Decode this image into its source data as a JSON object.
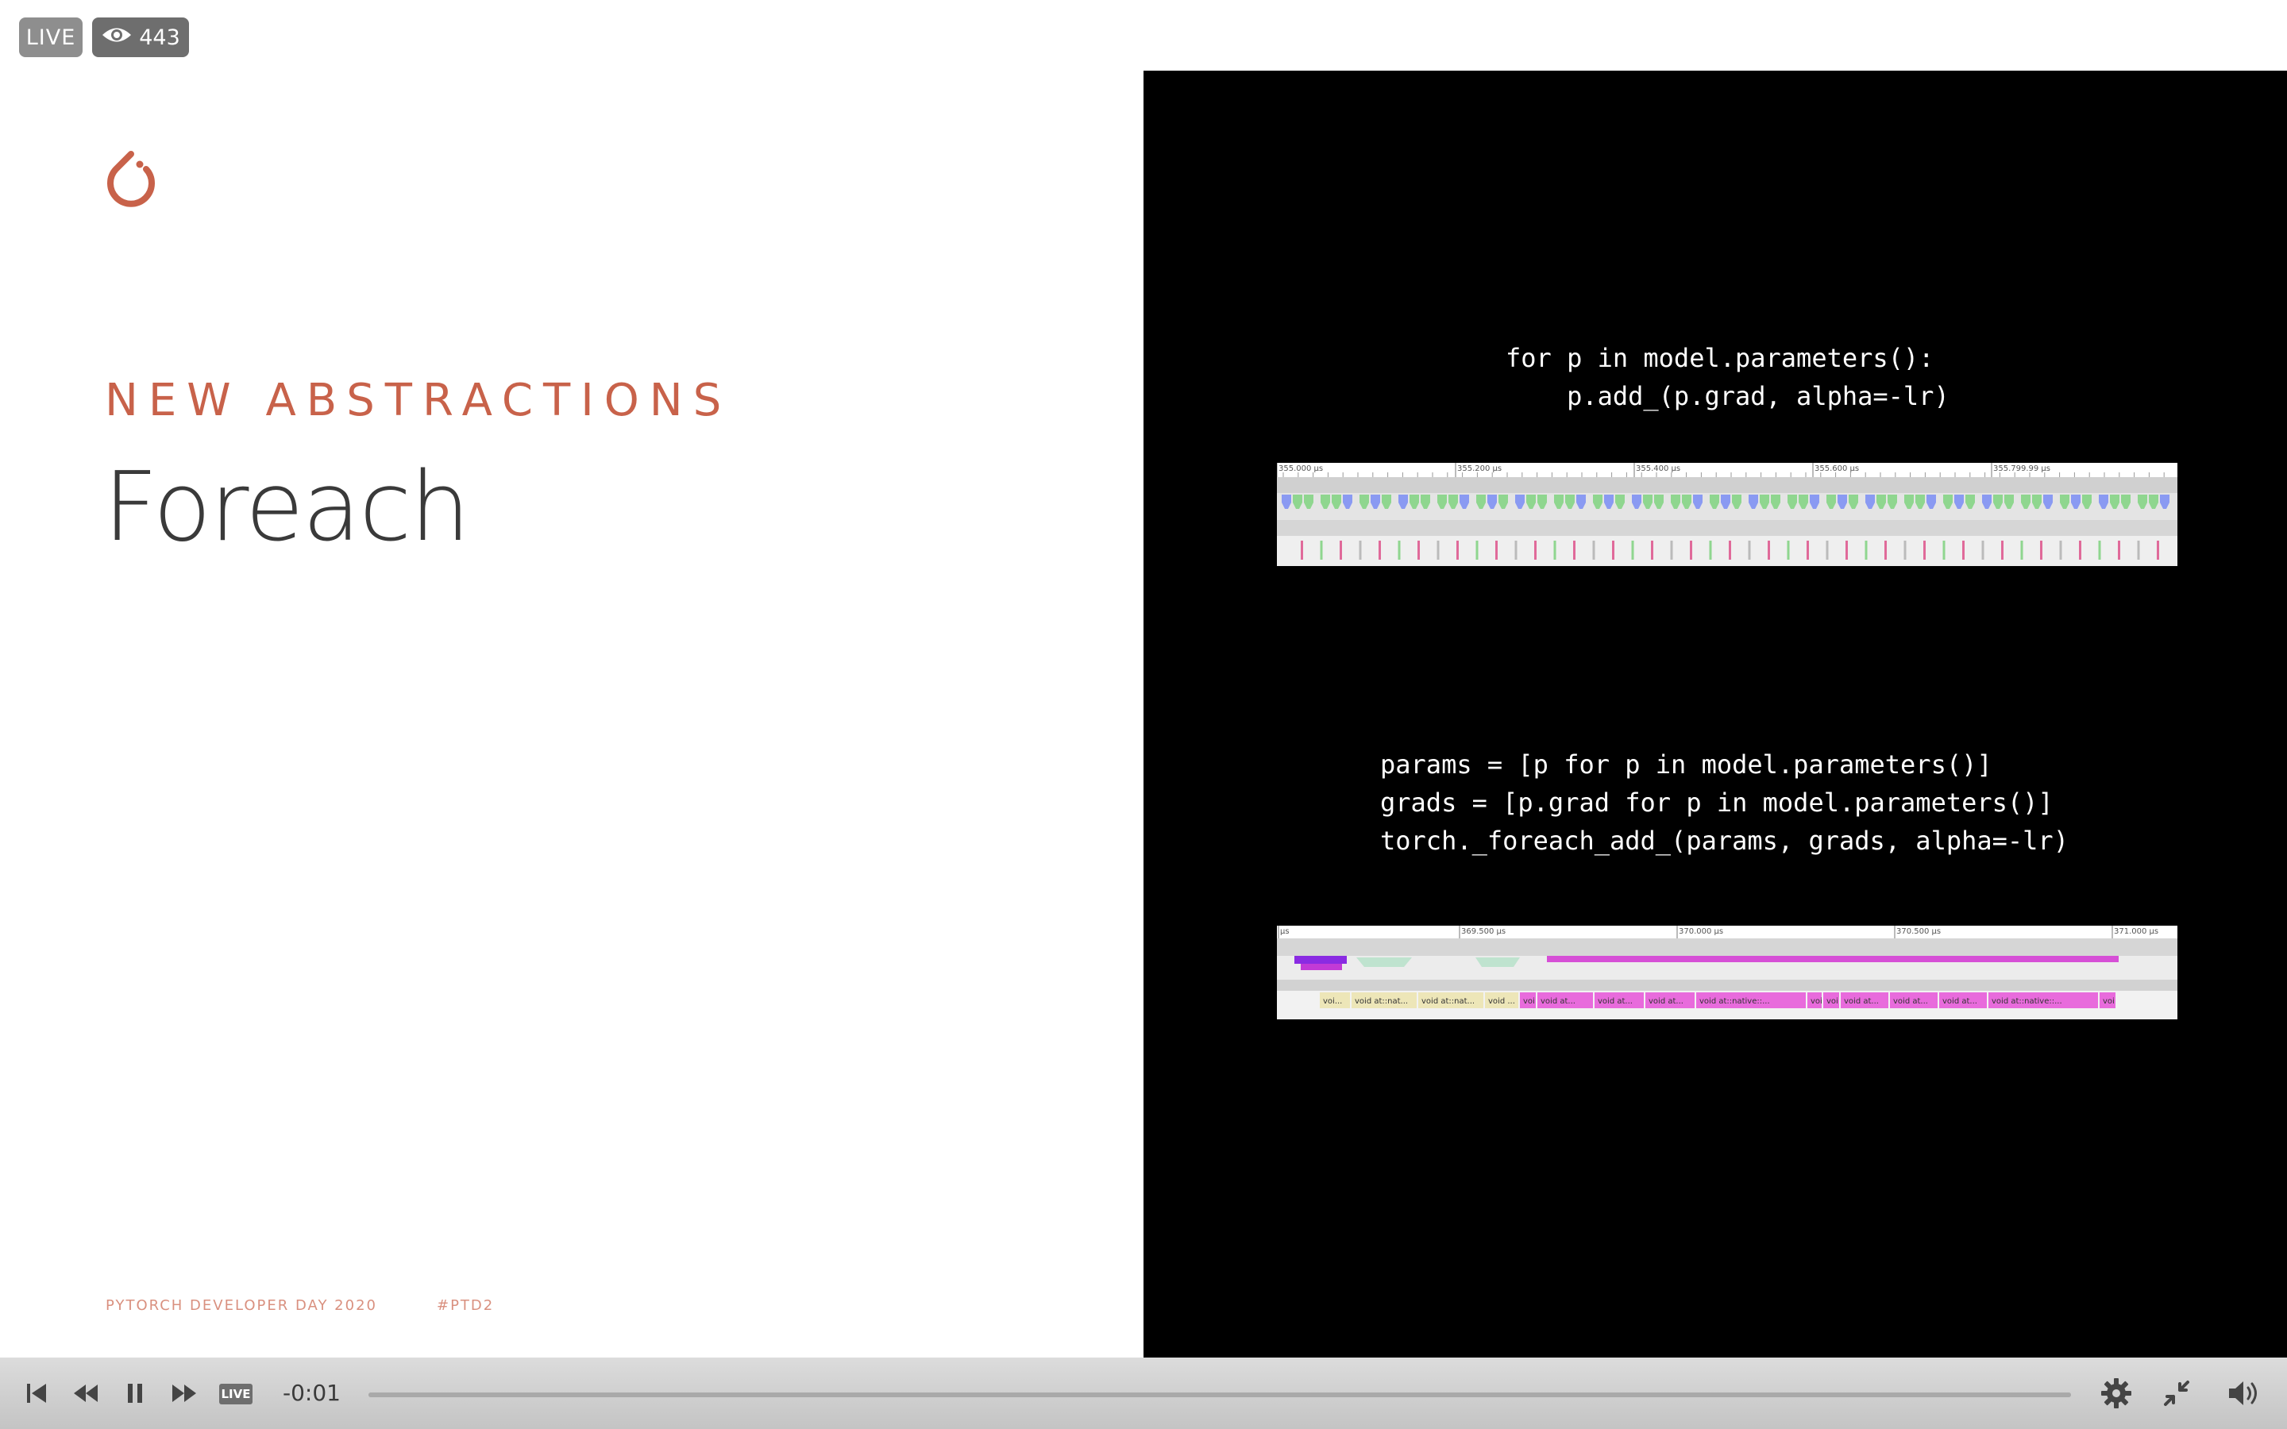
{
  "overlay": {
    "live_label": "LIVE",
    "viewer_count": "443",
    "viewer_icon": "eye-icon"
  },
  "slide": {
    "logo_icon": "pytorch-flame-icon",
    "kicker": "NEW ABSTRACTIONS",
    "title": "Foreach",
    "footer_event": "PYTORCH DEVELOPER DAY 2020",
    "footer_hashtag": "#PTD2",
    "colors": {
      "accent": "#c8624a",
      "title": "#3a3a3a",
      "panel": "#000000"
    },
    "code_top": "for p in model.parameters():\n    p.add_(p.grad, alpha=-lr)",
    "code_bottom": "params = [p for p in model.parameters()]\ngrads = [p.grad for p in model.parameters()]\ntorch._foreach_add_(params, grads, alpha=-lr)",
    "trace_top": {
      "ticks": [
        "355.000 µs",
        "355.200 µs",
        "355.400 µs",
        "355.600 µs",
        "355.799.99 µs"
      ]
    },
    "trace_bottom": {
      "ticks": [
        "µs",
        "369.500 µs",
        "370.000 µs",
        "370.500 µs",
        "371.000 µs"
      ],
      "labels": [
        "voi...",
        "void at::nat...",
        "void at::nat...",
        "void ...",
        "voi",
        "void at...",
        "void at...",
        "void at...",
        "void at::native::...",
        "voi",
        "voi",
        "void at...",
        "void at...",
        "void at...",
        "void at::native::...",
        "voi"
      ]
    }
  },
  "player": {
    "live_button_label": "LIVE",
    "time": "-0:01",
    "progress": 1.0,
    "icons": {
      "skip_back": "skip-back-icon",
      "rewind": "rewind-icon",
      "pause": "pause-icon",
      "fast_forward": "fast-forward-icon",
      "settings": "gear-icon",
      "exit_fullscreen": "exit-fullscreen-icon",
      "volume": "volume-icon"
    }
  }
}
